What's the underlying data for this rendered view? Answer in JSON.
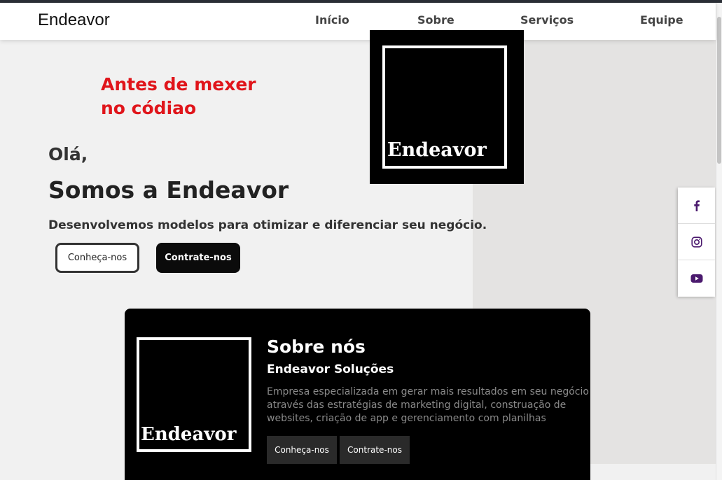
{
  "navbar": {
    "brand": "Endeavor",
    "links": [
      "Início",
      "Sobre",
      "Serviços",
      "Equipe"
    ]
  },
  "note": {
    "line1": "Antes de mexer",
    "line2": "no códiao"
  },
  "hero": {
    "logo_text": "Endeavor",
    "greeting": "Olá,",
    "headline": "Somos a Endeavor",
    "subline": "Desenvolvemos modelos para otimizar e diferenciar seu negócio.",
    "btn_primary": "Conheça-nos",
    "btn_secondary": "Contrate-nos"
  },
  "social": {
    "icons": [
      "facebook-icon",
      "instagram-icon",
      "youtube-icon"
    ],
    "color": "#4b1a6e"
  },
  "about": {
    "logo_text": "Endeavor",
    "title": "Sobre nós",
    "subtitle": "Endeavor Soluções",
    "description": "Empresa especializada em gerar mais resultados em seu negócio através das estratégias de marketing digital, construação de websites, criação de app e gerenciamento com planilhas",
    "btn_primary": "Conheça-nos",
    "btn_secondary": "Contrate-nos"
  },
  "colors": {
    "note_red": "#e0151b",
    "dark": "#000000",
    "panel_gray": "#e4e3e2"
  }
}
